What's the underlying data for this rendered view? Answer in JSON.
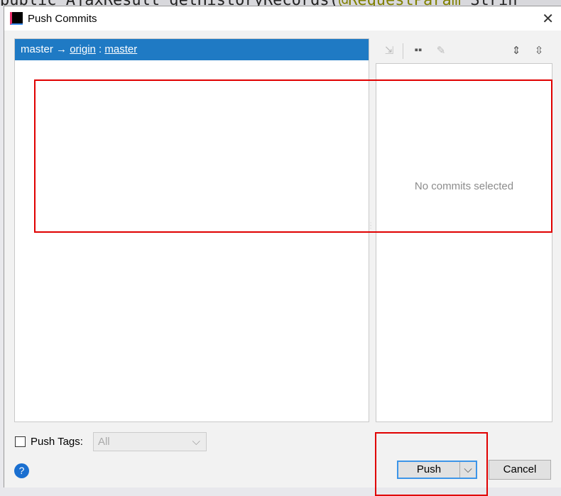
{
  "background_code": {
    "text": "public AjaxResult getHistoryRecords(",
    "annotation": "@RequestParam",
    "rest": " Strin"
  },
  "dialog": {
    "title": "Push Commits",
    "logo_text": "IJ",
    "close_icon": "close-icon",
    "branch_row": {
      "local": "master",
      "arrow": "→",
      "remote": "origin",
      "sep": " : ",
      "remote_branch": "master"
    },
    "toolbar_icons": [
      "compare-icon",
      "group-icon",
      "edit-icon",
      "expand-all-icon",
      "collapse-all-icon"
    ],
    "details_empty": "No commits selected",
    "push_tags_label": "Push Tags:",
    "push_tags_checked": false,
    "push_tags_value": "All",
    "push_button": "Push",
    "cancel_button": "Cancel",
    "help": "?"
  },
  "colors": {
    "selection": "#1f7ac4",
    "highlight_box": "#e00000",
    "default_button_border": "#3d95e8"
  }
}
